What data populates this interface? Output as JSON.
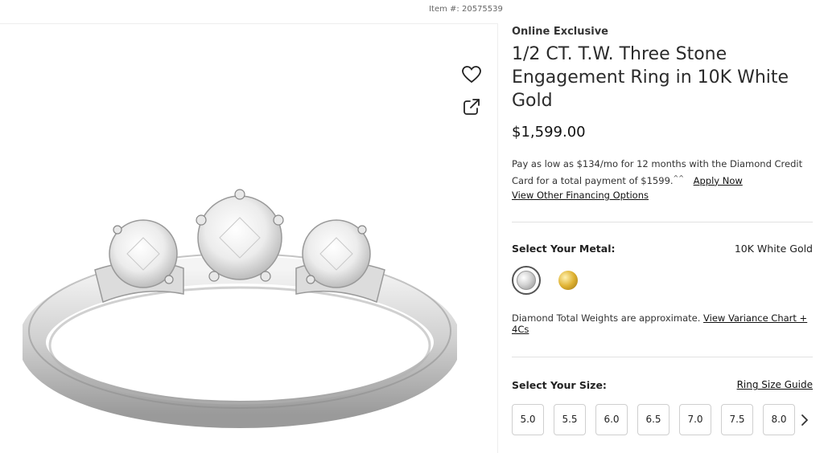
{
  "page": {
    "item_number": "Item #: 20575539"
  },
  "product": {
    "badge": "Online Exclusive",
    "title": "1/2 CT. T.W. Three Stone Engagement Ring in 10K White Gold",
    "price": "$1,599.00",
    "financing_text_1": "Pay as low as $134/mo for 12 months with the Diamond Credit Card for a total payment of $1599.",
    "financing_sup": "^^",
    "apply_now": "Apply Now",
    "other_financing": "View Other Financing Options"
  },
  "metal": {
    "label": "Select Your Metal:",
    "selected_value": "10K White Gold",
    "options": [
      {
        "name": "white-gold",
        "color": "#c9c9c9"
      },
      {
        "name": "yellow-gold",
        "color": "#d4a52a"
      }
    ]
  },
  "weights": {
    "note": "Diamond Total Weights are approximate.",
    "chart_link": "View Variance Chart + 4Cs"
  },
  "size": {
    "label": "Select Your Size:",
    "guide_link": "Ring Size Guide",
    "options": [
      "5.0",
      "5.5",
      "6.0",
      "6.5",
      "7.0",
      "7.5",
      "8.0"
    ]
  },
  "icons": {
    "favorite": "heart-icon",
    "share": "share-icon",
    "next": "chevron-right-icon"
  }
}
